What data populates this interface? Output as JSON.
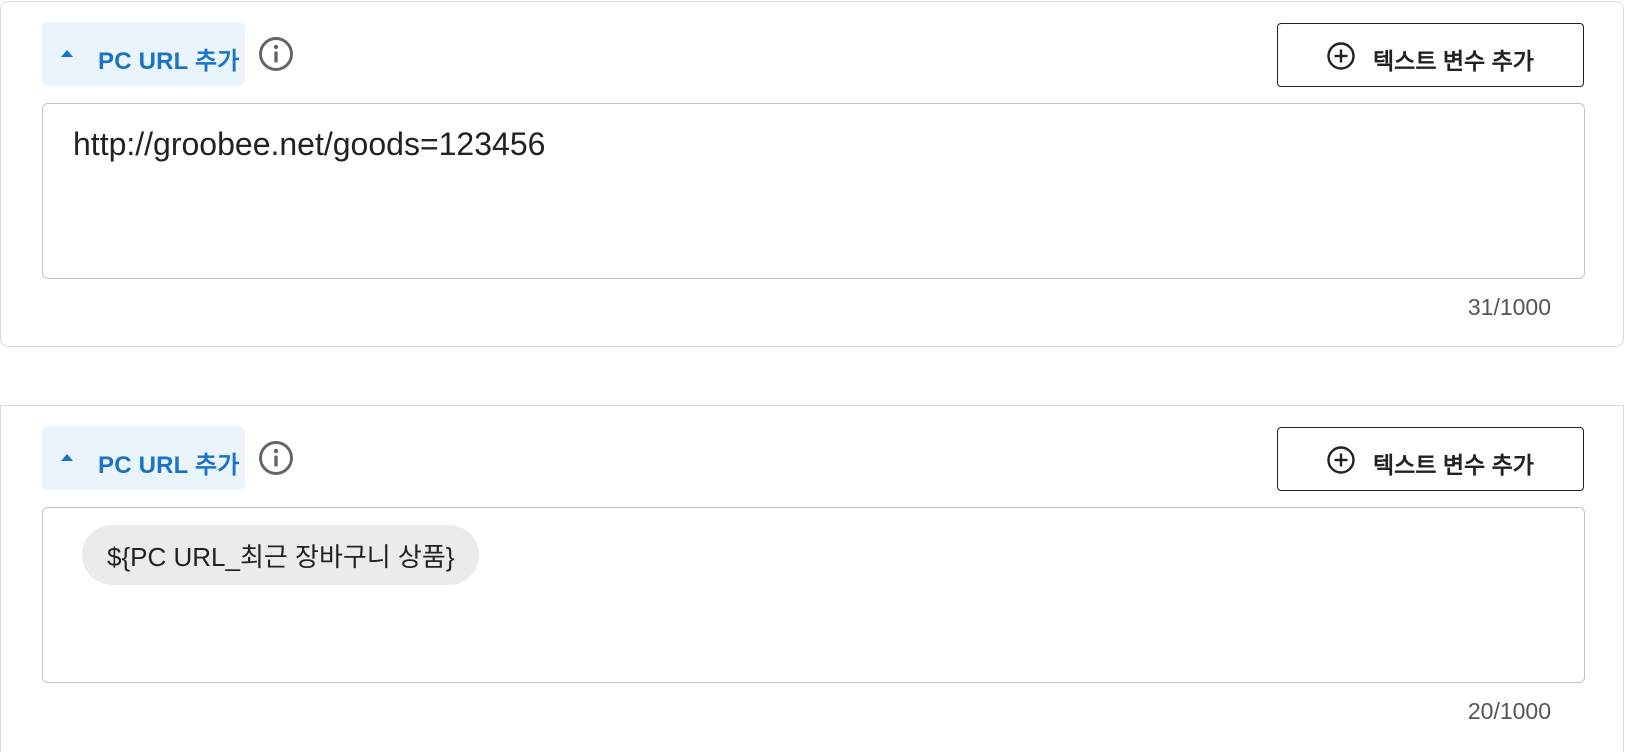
{
  "sections": [
    {
      "toggle_label": "PC URL 추가",
      "add_var_label": "텍스트 변수 추가",
      "url_value": "http://groobee.net/goods=123456",
      "char_count": "31/1000"
    },
    {
      "toggle_label": "PC URL 추가",
      "add_var_label": "텍스트 변수 추가",
      "variable_chip": "${PC URL_최근 장바구니 상품}",
      "char_count": "20/1000"
    }
  ],
  "icons": {
    "toggle": "caret-up-icon",
    "info": "info-icon",
    "add": "plus-circle-icon"
  },
  "colors": {
    "accent": "#1a73c7",
    "toggle_bg": "#eaf4fd",
    "chip_bg": "#ebebeb",
    "border": "#c4c4c4"
  }
}
